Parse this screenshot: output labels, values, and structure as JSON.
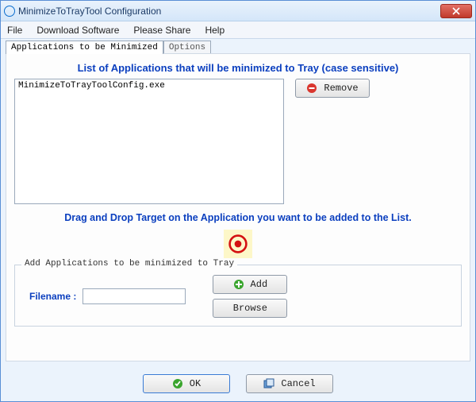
{
  "window": {
    "title": "MinimizeToTrayTool Configuration"
  },
  "menu": {
    "file": "File",
    "download": "Download Software",
    "share": "Please Share",
    "help": "Help"
  },
  "tabs": {
    "apps": "Applications to be Minimized",
    "options": "Options"
  },
  "headings": {
    "list": "List of Applications that will be minimized to Tray (case sensitive)",
    "drag": "Drag and Drop Target on the Application you want to be added to the List."
  },
  "list": {
    "items": [
      "MinimizeToTrayToolConfig.exe"
    ]
  },
  "buttons": {
    "remove": "Remove",
    "add": "Add",
    "browse": "Browse",
    "ok": "OK",
    "cancel": "Cancel"
  },
  "group": {
    "legend": "Add Applications to be minimized to Tray",
    "filename_label": "Filename :",
    "filename_value": ""
  }
}
